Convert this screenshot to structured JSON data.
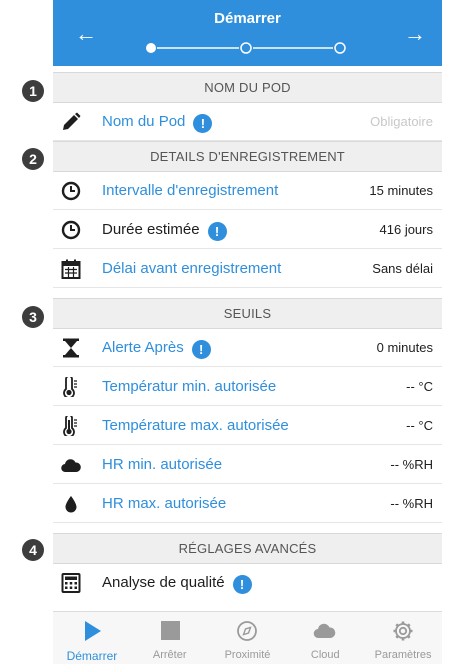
{
  "header": {
    "title": "Démarrer",
    "back_arrow": "←",
    "next_arrow": "→",
    "steps_total": 3,
    "current_step": 1
  },
  "markers": [
    "1",
    "2",
    "3",
    "4"
  ],
  "sections": {
    "pod_name": "NOM DU POD",
    "recording": "DETAILS D'ENREGISTREMENT",
    "thresholds": "SEUILS",
    "advanced": "RÉGLAGES AVANCÉS"
  },
  "rows": {
    "pod_name": {
      "label": "Nom du Pod",
      "info": "!",
      "value": "Obligatoire",
      "icon": "pencil-icon"
    },
    "interval": {
      "label": "Intervalle d'enregistrement",
      "value": "15 minutes",
      "icon": "clock-icon"
    },
    "duration": {
      "label": "Durée estimée",
      "info": "!",
      "value": "416 jours",
      "icon": "clock-icon"
    },
    "delay": {
      "label": "Délai avant enregistrement",
      "value": "Sans délai",
      "icon": "calendar-icon"
    },
    "alert_after": {
      "label": "Alerte Après",
      "info": "!",
      "value": "0 minutes",
      "icon": "hourglass-icon"
    },
    "temp_min": {
      "label": "Températur min. autorisée",
      "value": "-- °C",
      "icon": "thermometer-low-icon"
    },
    "temp_max": {
      "label": "Température max. autorisée",
      "value": "-- °C",
      "icon": "thermometer-high-icon"
    },
    "hr_min": {
      "label": "HR min. autorisée",
      "value": "-- %RH",
      "icon": "cloud-icon"
    },
    "hr_max": {
      "label": "HR max. autorisée",
      "value": "-- %RH",
      "icon": "drop-icon"
    },
    "quality": {
      "label": "Analyse de qualité",
      "info": "!",
      "icon": "calculator-icon"
    }
  },
  "bottom_nav": [
    {
      "label": "Démarrer",
      "icon": "play-icon",
      "active": true
    },
    {
      "label": "Arrêter",
      "icon": "stop-icon",
      "active": false
    },
    {
      "label": "Proximité",
      "icon": "compass-icon",
      "active": false
    },
    {
      "label": "Cloud",
      "icon": "cloud-icon",
      "active": false
    },
    {
      "label": "Paramètres",
      "icon": "gear-icon",
      "active": false
    }
  ],
  "colors": {
    "accent": "#2f8fdc",
    "section_bg": "#efefef",
    "text_dark": "#1e1e1e",
    "placeholder": "#c8c8c8",
    "nav_inactive": "#9a9a9a"
  }
}
